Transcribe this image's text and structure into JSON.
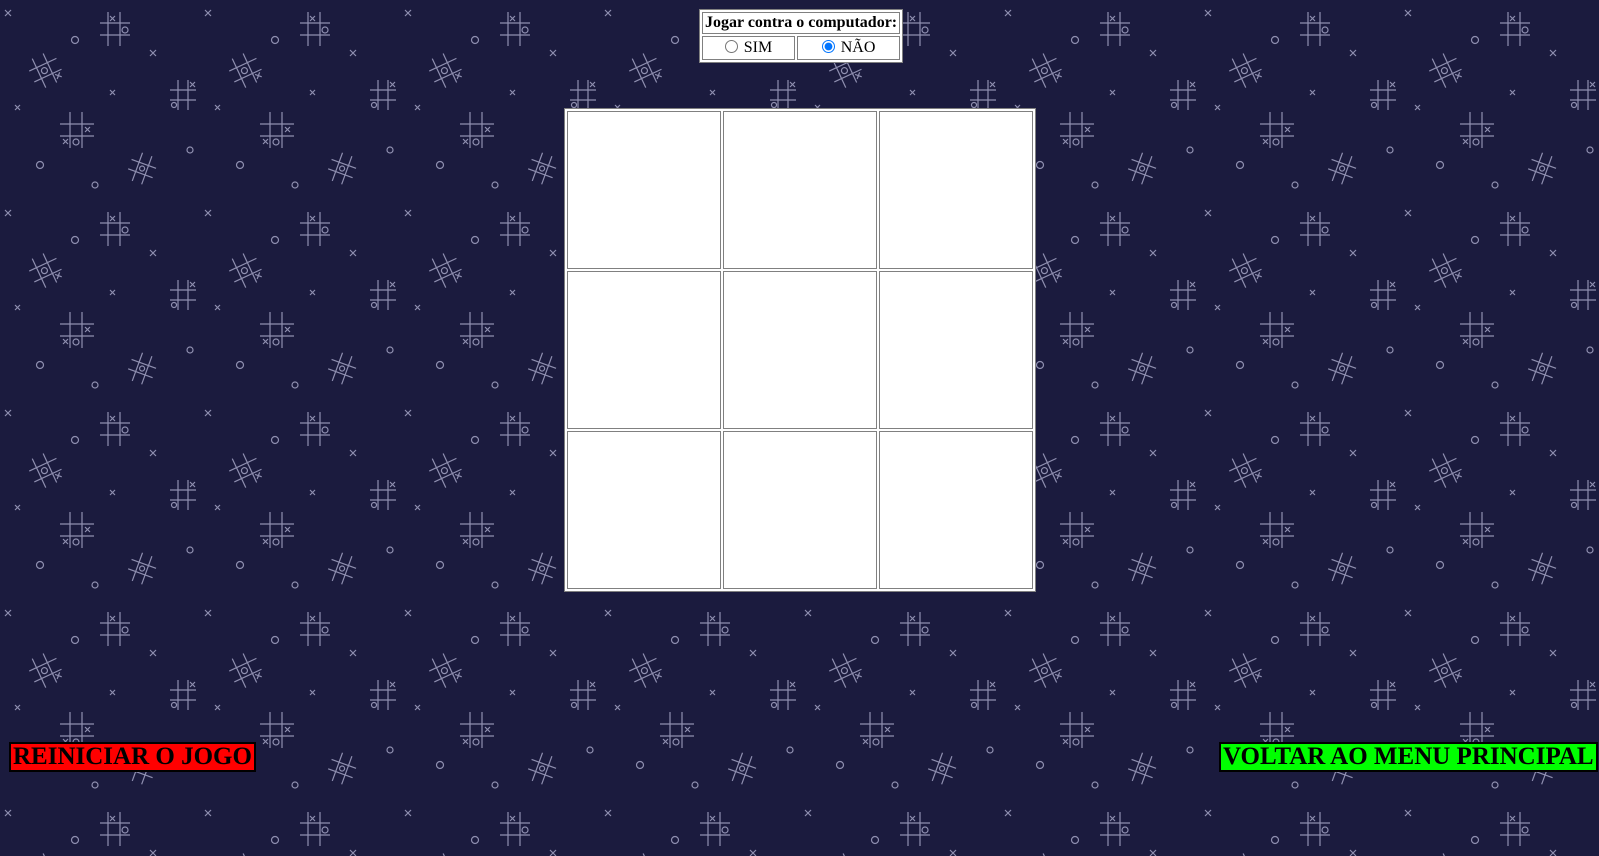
{
  "game": {
    "colors": {
      "background": "#1b1b3e",
      "pattern": "#8f8fb0",
      "board": "#ffffff",
      "restart_button": "#ff0000",
      "menu_button": "#00ff00"
    },
    "opponent": {
      "question": "Jogar contra o computador:",
      "options": [
        {
          "label": "SIM",
          "selected": false
        },
        {
          "label": "NÃO",
          "selected": true
        }
      ]
    },
    "board": {
      "cells": [
        "",
        "",
        "",
        "",
        "",
        "",
        "",
        "",
        ""
      ]
    },
    "buttons": {
      "restart": "REINICIAR O JOGO",
      "main_menu": "VOLTAR AO MENU PRINCIPAL"
    }
  }
}
